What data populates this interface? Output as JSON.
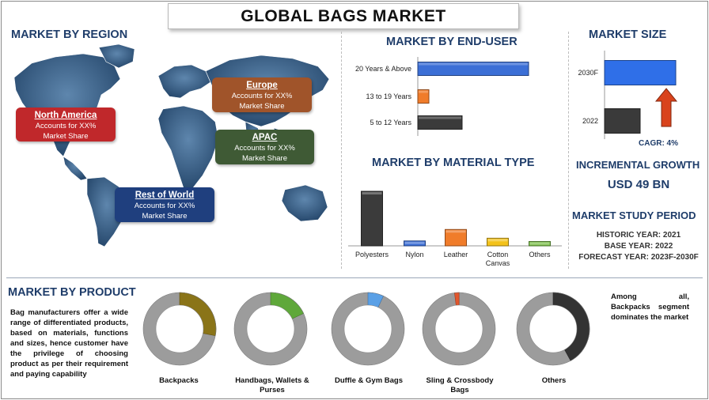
{
  "title": "GLOBAL BAGS MARKET",
  "region": {
    "heading": "MARKET BY REGION",
    "callouts": [
      {
        "name": "North America",
        "line1": "Accounts for XX%",
        "line2": "Market Share",
        "color": "#c0282b"
      },
      {
        "name": "Europe",
        "line1": "Accounts for XX%",
        "line2": "Market Share",
        "color": "#a0542a"
      },
      {
        "name": "APAC",
        "line1": "Accounts for XX%",
        "line2": "Market Share",
        "color": "#3f5a35"
      },
      {
        "name": "Rest of World",
        "line1": "Accounts for XX%",
        "line2": "Market Share",
        "color": "#1f3f7e"
      }
    ]
  },
  "end_user": {
    "heading": "MARKET BY END-USER"
  },
  "material": {
    "heading": "MARKET BY MATERIAL TYPE"
  },
  "market_size": {
    "heading": "MARKET SIZE",
    "cagr": "CAGR: 4%",
    "arrow_color": "#d9431c"
  },
  "growth": {
    "heading": "INCREMENTAL GROWTH",
    "value": "USD 49 BN"
  },
  "study_period": {
    "heading": "MARKET STUDY PERIOD",
    "historic": "HISTORIC YEAR: 2021",
    "base": "BASE YEAR: 2022",
    "forecast": "FORECAST YEAR: 2023F-2030F"
  },
  "product": {
    "heading": "MARKET BY PRODUCT",
    "description": "Bag manufacturers offer a wide range of differentiated products, based on materials, functions and sizes, hence customer have the privilege of choosing product as per their requirement and paying capability",
    "note": "Among all, Backpacks segment dominates the market"
  },
  "chart_data": [
    {
      "type": "bar",
      "orientation": "horizontal",
      "categories": [
        "20 Years & Above",
        "13 to 19 Years",
        "5 to 12 Years"
      ],
      "values": [
        100,
        10,
        40
      ],
      "colors": [
        "#3c6fd6",
        "#f07c2a",
        "#3b3b3b"
      ],
      "xlim": [
        0,
        100
      ],
      "grid": false
    },
    {
      "type": "bar",
      "categories": [
        "Polyesters",
        "Nylon",
        "Leather",
        "Cotton Canvas",
        "Others"
      ],
      "values": [
        100,
        9,
        30,
        14,
        8
      ],
      "colors": [
        "#3b3b3b",
        "#3c6fd6",
        "#f07c2a",
        "#f3c21a",
        "#7cbf4a"
      ],
      "ylim": [
        0,
        100
      ],
      "grid": false
    },
    {
      "type": "bar",
      "categories": [
        "2030F",
        "2022"
      ],
      "values": [
        100,
        50
      ],
      "colors": [
        "#2f6fe8",
        "#3a3a3a"
      ],
      "xlim": [
        0,
        100
      ],
      "grid": false
    },
    {
      "type": "pie",
      "style": "donut",
      "charts": [
        {
          "label": "Backpacks",
          "share": 0.28,
          "color": "#8a7418",
          "start_angle": 0
        },
        {
          "label": "Handbags, Wallets & Purses",
          "share": 0.18,
          "color": "#5fa83a",
          "start_angle": 0
        },
        {
          "label": "Duffle & Gym Bags",
          "share": 0.07,
          "color": "#5aa0e6",
          "start_angle": 0
        },
        {
          "label": "Sling & Crossbody Bags",
          "share": 0.02,
          "color": "#e2562c",
          "start_angle": -7
        },
        {
          "label": "Others",
          "share": 0.42,
          "color": "#333333",
          "start_angle": 0
        }
      ],
      "remainder_color": "#9c9c9c"
    }
  ]
}
